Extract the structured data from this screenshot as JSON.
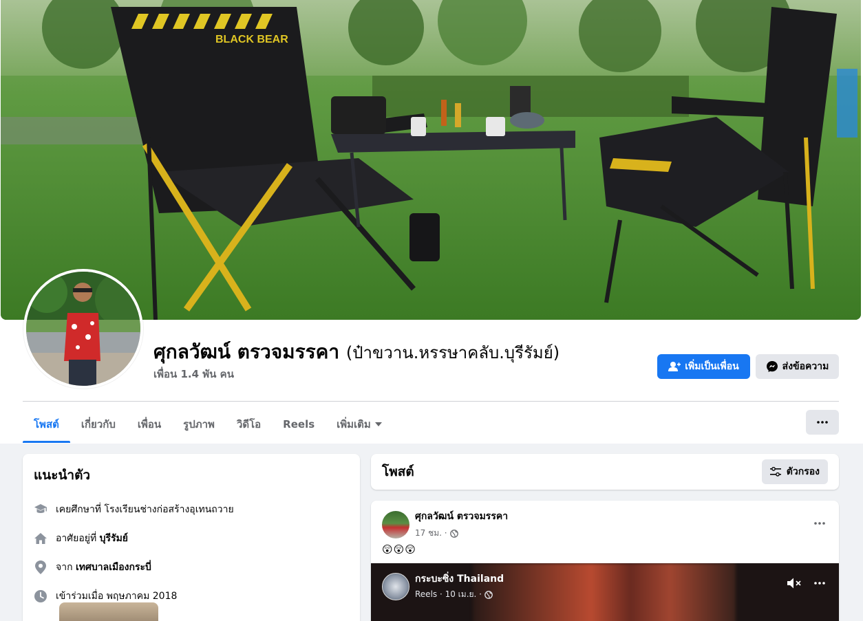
{
  "profile": {
    "name": "ศุกลวัฒน์ ตรวจมรรคา",
    "alternate_name": "(ป๋าขวาน.หรรษาคลับ.บุรีรัมย์)",
    "friends": "เพื่อน 1.4 พัน คน",
    "cover_text": "BLACK BEAR"
  },
  "actions": {
    "add_friend": "เพิ่มเป็นเพื่อน",
    "message": "ส่งข้อความ"
  },
  "tabs": [
    {
      "label": "โพสต์",
      "active": true
    },
    {
      "label": "เกี่ยวกับ"
    },
    {
      "label": "เพื่อน"
    },
    {
      "label": "รูปภาพ"
    },
    {
      "label": "วิดีโอ"
    },
    {
      "label": "Reels"
    },
    {
      "label": "เพิ่มเติม"
    }
  ],
  "intro": {
    "title": "แนะนำตัว",
    "items": [
      {
        "icon": "graduation-cap-icon",
        "prefix": "เคยศึกษาที่ โรงเรียนช่างก่อสร้างอุเทนถวาย",
        "bold": ""
      },
      {
        "icon": "home-icon",
        "prefix": "อาศัยอยู่ที่ ",
        "bold": "บุรีรัมย์"
      },
      {
        "icon": "location-pin-icon",
        "prefix": "จาก ",
        "bold": "เทศบาลเมืองกระบี่"
      },
      {
        "icon": "clock-icon",
        "prefix": "เข้าร่วมเมื่อ พฤษภาคม 2018",
        "bold": ""
      }
    ]
  },
  "posts_section": {
    "title": "โพสต์",
    "filter_label": "ตัวกรอง"
  },
  "post": {
    "author": "ศุกลวัฒน์ ตรวจมรรคา",
    "time": "17 ชม. ·",
    "text": "😲😲😲",
    "reel": {
      "author": "กระบะซิ่ง Thailand",
      "meta": "Reels · 10 เม.ย. ·"
    }
  },
  "colors": {
    "primary": "#1877f2",
    "secondary_bg": "#e4e6eb",
    "page_bg": "#f0f2f5",
    "muted_text": "#65676b"
  }
}
